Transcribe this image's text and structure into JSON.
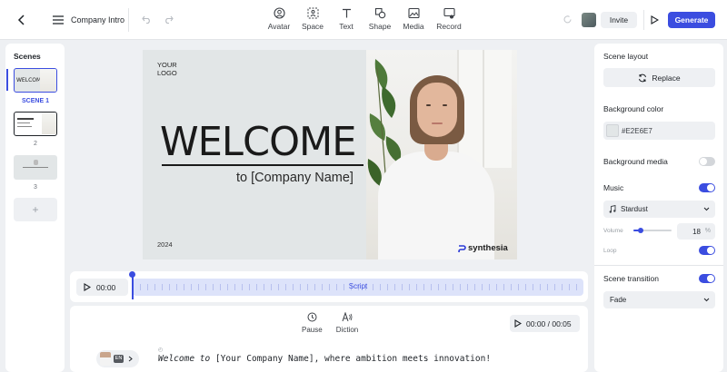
{
  "header": {
    "project_title": "Company Intro",
    "tools": [
      {
        "label": "Avatar",
        "icon": "avatar-icon"
      },
      {
        "label": "Space",
        "icon": "space-icon"
      },
      {
        "label": "Text",
        "icon": "text-icon"
      },
      {
        "label": "Shape",
        "icon": "shape-icon"
      },
      {
        "label": "Media",
        "icon": "media-icon"
      },
      {
        "label": "Record",
        "icon": "record-icon"
      }
    ],
    "invite_label": "Invite",
    "generate_label": "Generate"
  },
  "scenes": {
    "title": "Scenes",
    "items": [
      {
        "label": "SCENE 1",
        "selected": true
      },
      {
        "label": "2",
        "selected": false
      },
      {
        "label": "3",
        "selected": false
      }
    ],
    "add_label": "+"
  },
  "canvas": {
    "logo_line1": "YOUR",
    "logo_line2": "LOGO",
    "welcome": "WELCOME",
    "subtitle": "to [Company Name]",
    "year": "2024",
    "brand": "synthesia",
    "background_color": "#E2E6E7"
  },
  "timeline": {
    "time": "00:00",
    "track_label": "Script"
  },
  "script": {
    "pause_label": "Pause",
    "diction_label": "Diction",
    "playback_time": "00:00 / 00:05",
    "language_badge": "EN",
    "script_text_emphasis": "Welcome to",
    "script_text_rest": " [Your Company Name], where ambition meets innovation!"
  },
  "right_panel": {
    "scene_layout_title": "Scene layout",
    "replace_label": "Replace",
    "background_color_title": "Background color",
    "background_color_value": "#E2E6E7",
    "background_media_label": "Background media",
    "background_media_on": false,
    "music_label": "Music",
    "music_on": true,
    "music_track": "Stardust",
    "volume_label": "Volume",
    "volume_value": "18",
    "volume_unit": "%",
    "volume_level": 0.18,
    "loop_label": "Loop",
    "loop_on": true,
    "scene_transition_label": "Scene transition",
    "scene_transition_on": true,
    "transition_value": "Fade"
  },
  "colors": {
    "accent": "#3b4de0",
    "canvas_bg": "#E2E6E7"
  }
}
